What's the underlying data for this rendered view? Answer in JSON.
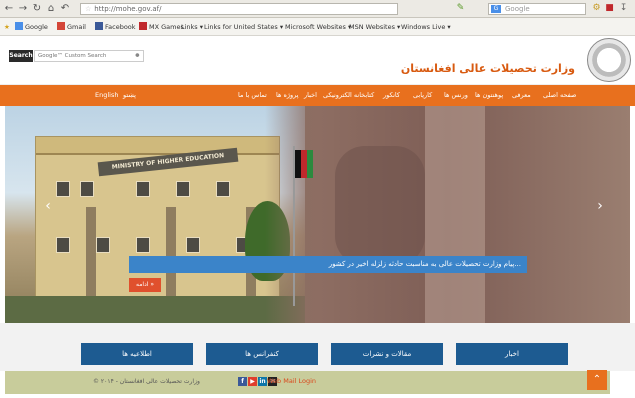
{
  "browser": {
    "url": "http://mohe.gov.af/",
    "search_placeholder": "Google",
    "search_engine_badge": "G"
  },
  "bookmarks": [
    "Google",
    "Gmail",
    "Facebook",
    "MX Games",
    "Links ▾",
    "Links for United States ▾",
    "Microsoft Websites ▾",
    "MSN Websites ▾",
    "Windows Live ▾"
  ],
  "site": {
    "search_button": "Search",
    "search_placeholder": "Google™ Custom Search",
    "title": "وزارت تحصیلات عالی افغانستان"
  },
  "nav": {
    "english": "English",
    "pashto": "پښتو",
    "items": [
      "صفحه اصلی",
      "معرفی",
      "پوهنتون ها",
      "ورنس ها",
      "کاریابی",
      "کانکور",
      "کتابخانه الکترونیکی",
      "اخبار",
      "پروژه ها",
      "تماس با ما"
    ]
  },
  "hero": {
    "sign_text": "MINISTRY OF HIGHER EDUCATION",
    "caption": "پیام وزارت تحصیلات عالی به مناسبت حادثه زلزله اخیر در کشور...",
    "read_more": "ادامه »"
  },
  "tiles": [
    "اطلاعیه ها",
    "کنفرانس ها",
    "مقالات و نشرات",
    "اخبار"
  ],
  "footer": {
    "copyright": "© وزارت تحصیلات عالی افغانستان - ۲۰۱۴",
    "web_mail": "Web Mail Login"
  },
  "colors": {
    "accent": "#e8701e",
    "tile_blue": "#1d5b91",
    "caption_blue": "#3b84c9",
    "footer_bg": "#c8cc9b"
  }
}
